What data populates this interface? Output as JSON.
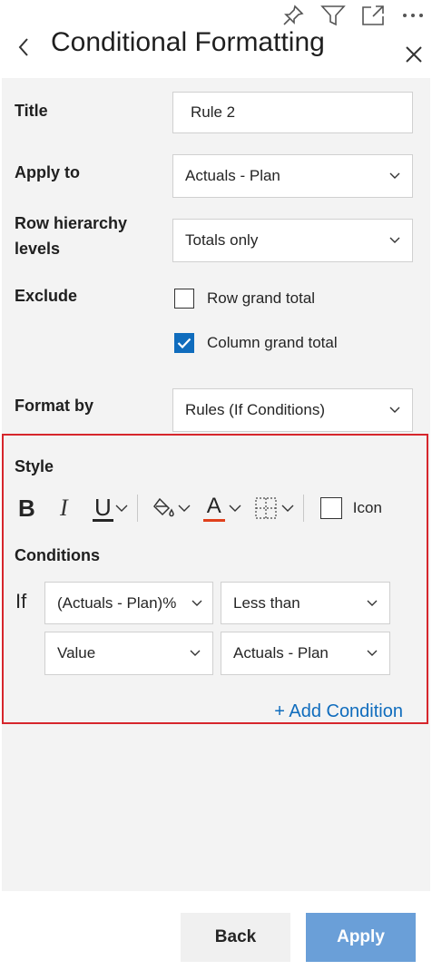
{
  "header": {
    "title": "Conditional Formatting",
    "icons": [
      "pin-icon",
      "filter-icon",
      "expand-icon",
      "more-icon",
      "back-arrow-icon",
      "close-icon"
    ]
  },
  "form": {
    "title_label": "Title",
    "title_value": "Rule 2",
    "apply_to_label": "Apply to",
    "apply_to_value": "Actuals - Plan",
    "row_hierarchy_label_line1": "Row hierarchy",
    "row_hierarchy_label_line2": "levels",
    "row_hierarchy_value": "Totals only",
    "exclude_label": "Exclude",
    "exclude_options": [
      {
        "label": "Row grand total",
        "checked": false
      },
      {
        "label": "Column grand total",
        "checked": true
      }
    ],
    "format_by_label": "Format by",
    "format_by_value": "Rules (If Conditions)"
  },
  "style": {
    "heading": "Style",
    "bold_glyph": "B",
    "italic_glyph": "I",
    "underline_glyph": "U",
    "font_color_glyph": "A",
    "font_color_swatch": "#e0401c",
    "icon_label": "Icon",
    "icon_checked": false
  },
  "conditions": {
    "heading": "Conditions",
    "if_label": "If",
    "rows": [
      {
        "field": "(Actuals - Plan)%",
        "operator": "Less than"
      },
      {
        "field": "Value",
        "operator": "Actuals - Plan"
      }
    ],
    "add_label": "+ Add Condition"
  },
  "footer": {
    "back_label": "Back",
    "apply_label": "Apply"
  },
  "colors": {
    "accent": "#0f6cbd",
    "apply_button": "#6a9fd8",
    "highlight_border": "#d6262c",
    "panel_bg": "#f3f3f3"
  }
}
